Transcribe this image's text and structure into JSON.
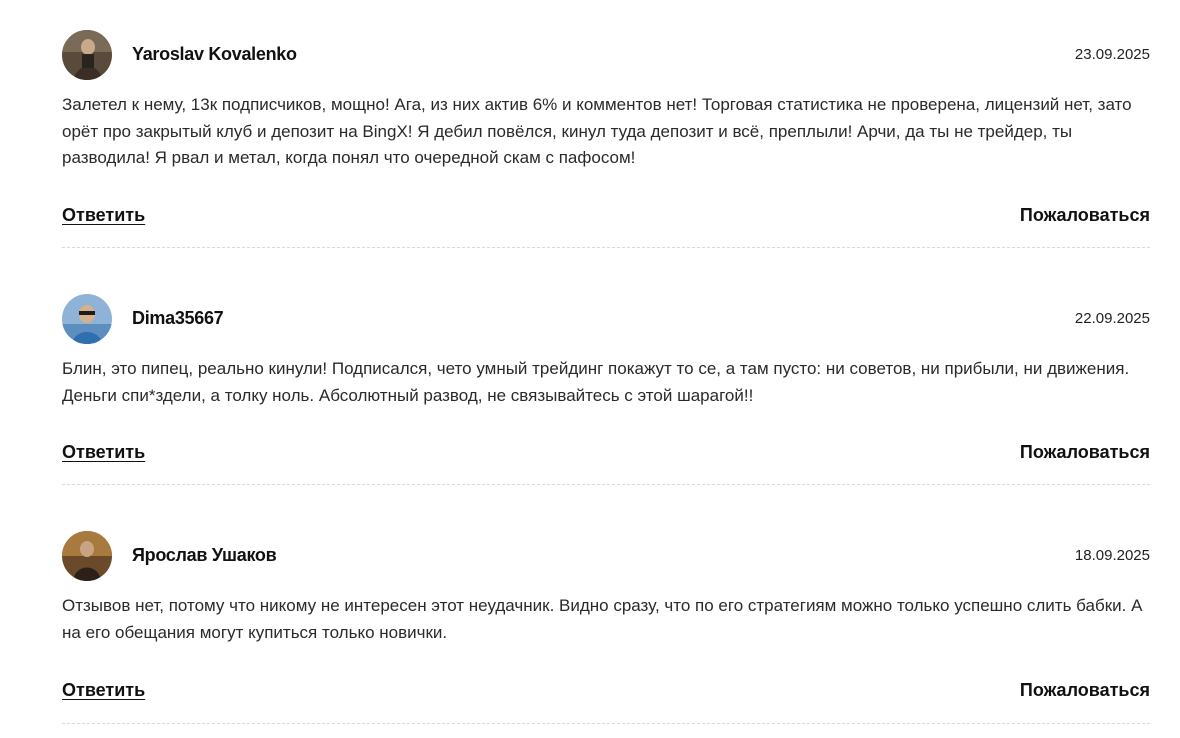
{
  "comments": [
    {
      "author": "Yaroslav Kovalenko",
      "date": "23.09.2025",
      "text": "Залетел к нему, 13к подписчиков, мощно! Ага, из них актив 6% и комментов нет! Торговая статистика не проверена, лицензий нет, зато орёт про закрытый клуб и депозит на BingX! Я дебил повёлся, кинул туда депозит и всё, преплыли! Арчи, да ты не трейдер, ты разводила! Я рвал и метал, когда понял что очередной скам с пафосом!",
      "reply_label": "Ответить",
      "report_label": "Пожаловаться"
    },
    {
      "author": "Dima35667",
      "date": "22.09.2025",
      "text": "Блин, это пипец, реально кинули! Подписался, чето умный трейдинг покажут то се, а там пусто: ни советов, ни прибыли, ни движения. Деньги спи*здели, а толку ноль. Абсолютный развод, не связывайтесь с этой шарагой!!",
      "reply_label": "Ответить",
      "report_label": "Пожаловаться"
    },
    {
      "author": "Ярослав Ушаков",
      "date": "18.09.2025",
      "text": "Отзывов нет, потому что никому не интересен этот неудачник. Видно сразу, что по его стратегиям можно только успешно слить бабки. А на его обещания могут купиться только новички.",
      "reply_label": "Ответить",
      "report_label": "Пожаловаться"
    }
  ]
}
